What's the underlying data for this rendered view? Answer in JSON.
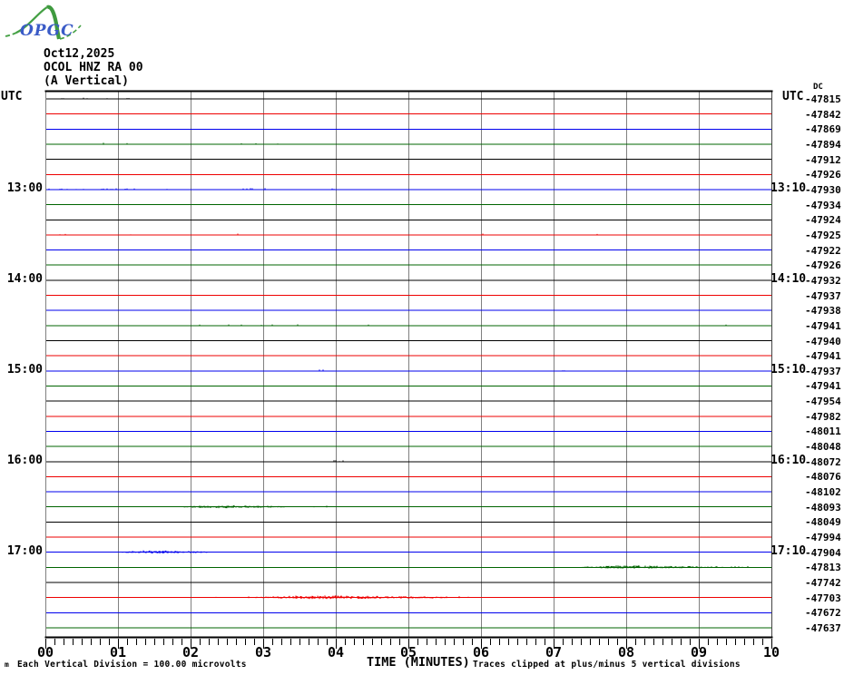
{
  "header": {
    "logo_text": "OPGC",
    "date": "Oct12,2025",
    "station": "OCOL HNZ RA 00",
    "component": "(A Vertical)",
    "utc_left": "UTC",
    "utc_right": "UTC",
    "dc_header": "DC"
  },
  "footer": {
    "left_glyph": "m",
    "scale_note": "Each Vertical Division =  100.00 microvolts",
    "time_axis_label": "TIME (MINUTES)",
    "clip_note": "Traces clipped at plus/minus 5 vertical divisions"
  },
  "chart_data": {
    "type": "line",
    "title": "OPGC webicorder OCOL HNZ RA 00 (A Vertical) Oct12,2025",
    "xlabel": "TIME (MINUTES)",
    "x_range_minutes": [
      0,
      10
    ],
    "x_tick_labels": [
      "00",
      "01",
      "02",
      "03",
      "04",
      "05",
      "06",
      "07",
      "08",
      "09",
      "10"
    ],
    "minor_ticks_per_minute": 8,
    "minutes_per_row": 10,
    "grid": true,
    "grid_color": "#808080",
    "axis_color": "#000000",
    "trace_color_cycle": [
      "#000000",
      "#ee0000",
      "#0000ee",
      "#006400"
    ],
    "rows": [
      {
        "left_label": null,
        "right_label": null,
        "dc": -47815
      },
      {
        "left_label": null,
        "right_label": null,
        "dc": -47842
      },
      {
        "left_label": null,
        "right_label": null,
        "dc": -47869
      },
      {
        "left_label": null,
        "right_label": null,
        "dc": -47894
      },
      {
        "left_label": null,
        "right_label": null,
        "dc": -47912
      },
      {
        "left_label": null,
        "right_label": null,
        "dc": -47926
      },
      {
        "left_label": "13:00",
        "right_label": "13:10",
        "dc": -47930
      },
      {
        "left_label": null,
        "right_label": null,
        "dc": -47934
      },
      {
        "left_label": null,
        "right_label": null,
        "dc": -47924
      },
      {
        "left_label": null,
        "right_label": null,
        "dc": -47925
      },
      {
        "left_label": null,
        "right_label": null,
        "dc": -47922
      },
      {
        "left_label": null,
        "right_label": null,
        "dc": -47926
      },
      {
        "left_label": "14:00",
        "right_label": "14:10",
        "dc": -47932
      },
      {
        "left_label": null,
        "right_label": null,
        "dc": -47937
      },
      {
        "left_label": null,
        "right_label": null,
        "dc": -47938
      },
      {
        "left_label": null,
        "right_label": null,
        "dc": -47941
      },
      {
        "left_label": null,
        "right_label": null,
        "dc": -47940
      },
      {
        "left_label": null,
        "right_label": null,
        "dc": -47941
      },
      {
        "left_label": "15:00",
        "right_label": "15:10",
        "dc": -47937
      },
      {
        "left_label": null,
        "right_label": null,
        "dc": -47941
      },
      {
        "left_label": null,
        "right_label": null,
        "dc": -47954
      },
      {
        "left_label": null,
        "right_label": null,
        "dc": -47982
      },
      {
        "left_label": null,
        "right_label": null,
        "dc": -48011
      },
      {
        "left_label": null,
        "right_label": null,
        "dc": -48048
      },
      {
        "left_label": "16:00",
        "right_label": "16:10",
        "dc": -48072
      },
      {
        "left_label": null,
        "right_label": null,
        "dc": -48076
      },
      {
        "left_label": null,
        "right_label": null,
        "dc": -48102
      },
      {
        "left_label": null,
        "right_label": null,
        "dc": -48093
      },
      {
        "left_label": null,
        "right_label": null,
        "dc": -48049
      },
      {
        "left_label": null,
        "right_label": null,
        "dc": -47994
      },
      {
        "left_label": "17:00",
        "right_label": "17:10",
        "dc": -47904
      },
      {
        "left_label": null,
        "right_label": null,
        "dc": -47813
      },
      {
        "left_label": null,
        "right_label": null,
        "dc": -47742
      },
      {
        "left_label": null,
        "right_label": null,
        "dc": -47703
      },
      {
        "left_label": null,
        "right_label": null,
        "dc": -47672
      },
      {
        "left_label": null,
        "right_label": null,
        "dc": -47637
      }
    ],
    "events": [
      {
        "row": 1,
        "start": 0.2,
        "end": 1.5,
        "amp": 1.3,
        "density": 0.1
      },
      {
        "row": 4,
        "start": 0.7,
        "end": 1.15,
        "amp": 1.8,
        "density": 0.25
      },
      {
        "row": 4,
        "start": 2.7,
        "end": 3.2,
        "amp": 1.4,
        "density": 0.12
      },
      {
        "row": 7,
        "start": 0.05,
        "end": 1.9,
        "amp": 1.4,
        "density": 0.1
      },
      {
        "row": 7,
        "start": 2.7,
        "end": 3.05,
        "amp": 1.6,
        "density": 0.3
      },
      {
        "row": 7,
        "start": 3.95,
        "end": 4.1,
        "amp": 1.3,
        "density": 0.3
      },
      {
        "row": 10,
        "start": 0.1,
        "end": 9.6,
        "amp": 1.6,
        "density": 0.03
      },
      {
        "row": 16,
        "start": 0.5,
        "end": 9.9,
        "amp": 1.4,
        "density": 0.025
      },
      {
        "row": 19,
        "start": 3.75,
        "end": 3.9,
        "amp": 1.5,
        "density": 0.4
      },
      {
        "row": 19,
        "start": 7.1,
        "end": 7.2,
        "amp": 1.2,
        "density": 0.3
      },
      {
        "row": 25,
        "start": 3.95,
        "end": 4.15,
        "amp": 1.5,
        "density": 0.35
      },
      {
        "row": 28,
        "start": 1.85,
        "end": 3.3,
        "amp": 2.4,
        "density": 1
      },
      {
        "row": 28,
        "start": 3.3,
        "end": 3.9,
        "amp": 1.5,
        "density": 0.15
      },
      {
        "row": 31,
        "start": 1.05,
        "end": 2.25,
        "amp": 2.4,
        "density": 1
      },
      {
        "row": 31,
        "start": 2.25,
        "end": 2.6,
        "amp": 1.5,
        "density": 0.15
      },
      {
        "row": 32,
        "start": 7.4,
        "end": 9.25,
        "amp": 2.4,
        "density": 1
      },
      {
        "row": 32,
        "start": 9.25,
        "end": 9.7,
        "amp": 1.4,
        "density": 0.12
      },
      {
        "row": 34,
        "start": 2.2,
        "end": 2.9,
        "amp": 1.5,
        "density": 0.08
      },
      {
        "row": 34,
        "start": 2.9,
        "end": 5.5,
        "amp": 2.8,
        "density": 1
      },
      {
        "row": 34,
        "start": 5.5,
        "end": 5.9,
        "amp": 1.8,
        "density": 0.12
      }
    ]
  }
}
